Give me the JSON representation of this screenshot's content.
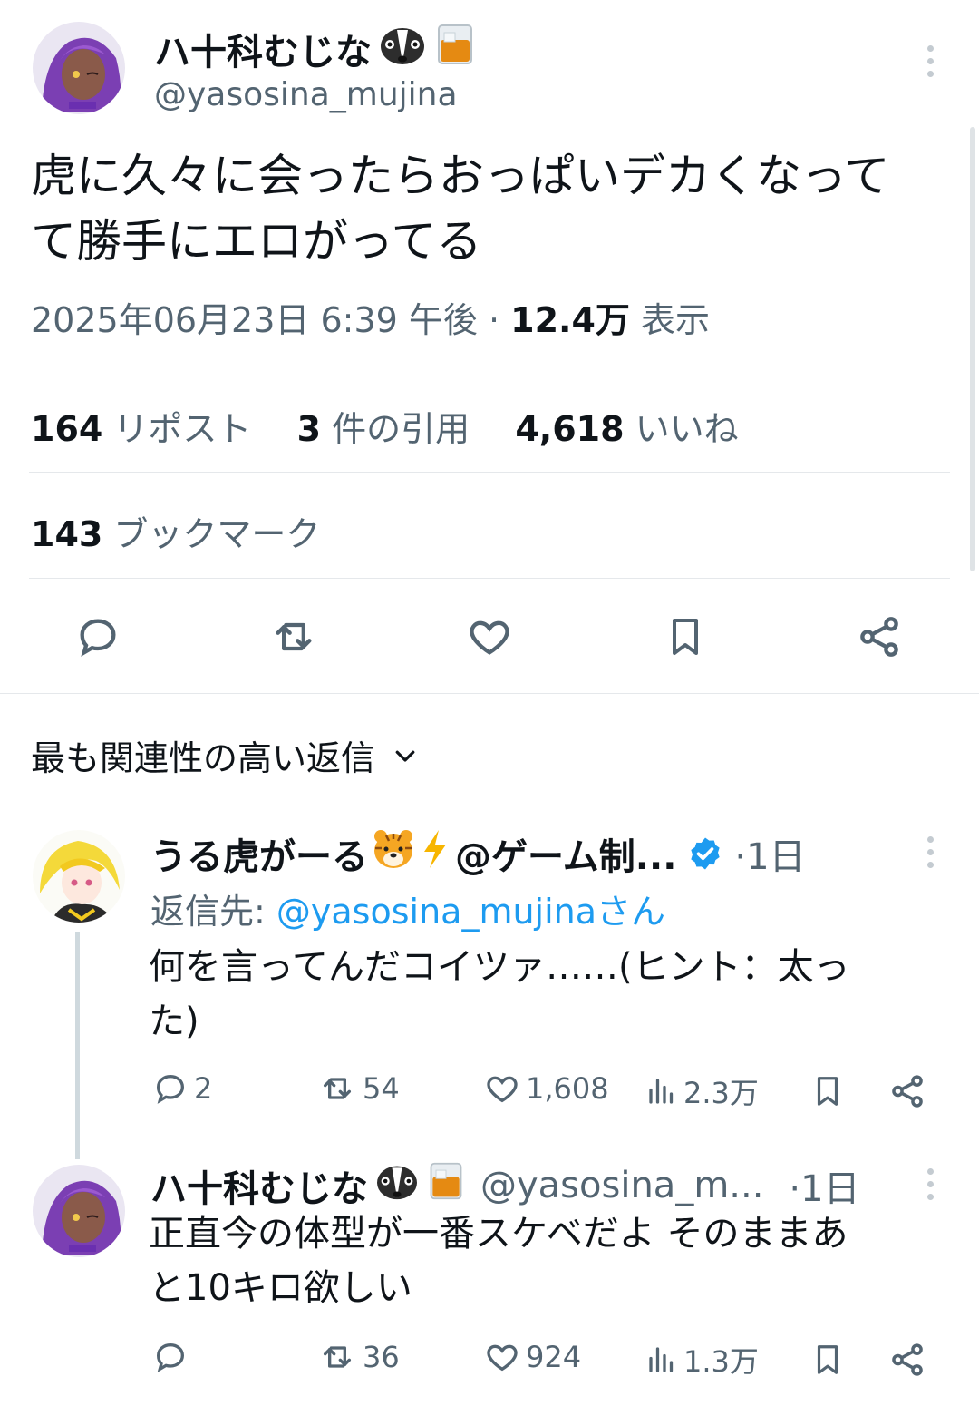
{
  "main_tweet": {
    "display_name": "ハ十科むじな",
    "handle": "@yasosina_mujina",
    "text_line1": "虎に久々に会ったらおっぱいデカくなって",
    "text_line2": "て勝手にエロがってる",
    "timestamp": "2025年06月23日 6:39 午後 · ",
    "views_count": "12.4万",
    "views_label": " 表示",
    "reposts_count": "164",
    "reposts_label": " リポスト",
    "quotes_count": "3",
    "quotes_label": " 件の引用",
    "likes_count": "4,618",
    "likes_label": " いいね",
    "bookmarks_count": "143",
    "bookmarks_label": " ブックマーク"
  },
  "replies_sort": {
    "label": "最も関連性の高い返信"
  },
  "reply1": {
    "display_name": "うる虎がーる",
    "name_suffix": "@ゲーム制...",
    "time": "·1日",
    "reply_to_prefix": "返信先: ",
    "reply_to_handle": "@yasosina_mujinaさん",
    "text_line1": "何を言ってんだコイツァ……(ヒント：太っ",
    "text_line2": "た)",
    "replies": "2",
    "reposts": "54",
    "likes": "1,608",
    "views": "2.3万"
  },
  "reply2": {
    "display_name": "ハ十科むじな",
    "handle": "@yasosina_m...",
    "time": "·1日",
    "text_line1": "正直今の体型が一番スケベだよ そのままあ",
    "text_line2": "と10キロ欲しい",
    "replies": "",
    "reposts": "36",
    "likes": "924",
    "views": "1.3万"
  },
  "colors": {
    "text": "#0f1419",
    "muted": "#536471",
    "link": "#1d9bf0",
    "divider": "#e5e8eb"
  }
}
